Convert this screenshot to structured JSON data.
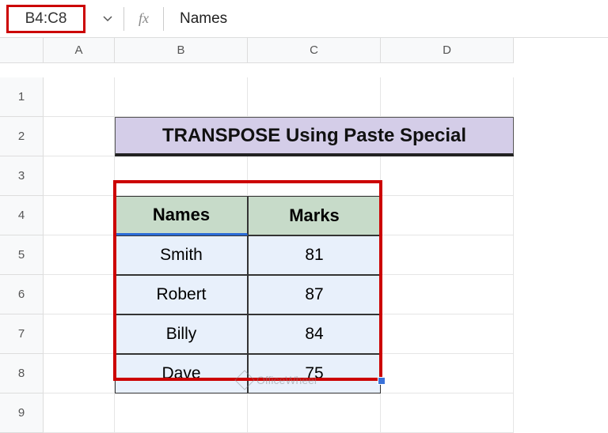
{
  "formula_bar": {
    "name_box": "B4:C8",
    "fx_label": "fx",
    "formula_value": "Names"
  },
  "columns": [
    "A",
    "B",
    "C",
    "D"
  ],
  "rows": [
    "1",
    "2",
    "3",
    "4",
    "5",
    "6",
    "7",
    "8",
    "9"
  ],
  "title": "TRANSPOSE Using Paste Special",
  "table": {
    "headers": {
      "col_b": "Names",
      "col_c": "Marks"
    },
    "rows": [
      {
        "name": "Smith",
        "mark": "81"
      },
      {
        "name": "Robert",
        "mark": "87"
      },
      {
        "name": "Billy",
        "mark": "84"
      },
      {
        "name": "Dave",
        "mark": "75"
      }
    ]
  },
  "watermark": "OfficeWheel",
  "chart_data": {
    "type": "table",
    "title": "TRANSPOSE Using Paste Special",
    "columns": [
      "Names",
      "Marks"
    ],
    "rows": [
      [
        "Smith",
        81
      ],
      [
        "Robert",
        87
      ],
      [
        "Billy",
        84
      ],
      [
        "Dave",
        75
      ]
    ]
  }
}
